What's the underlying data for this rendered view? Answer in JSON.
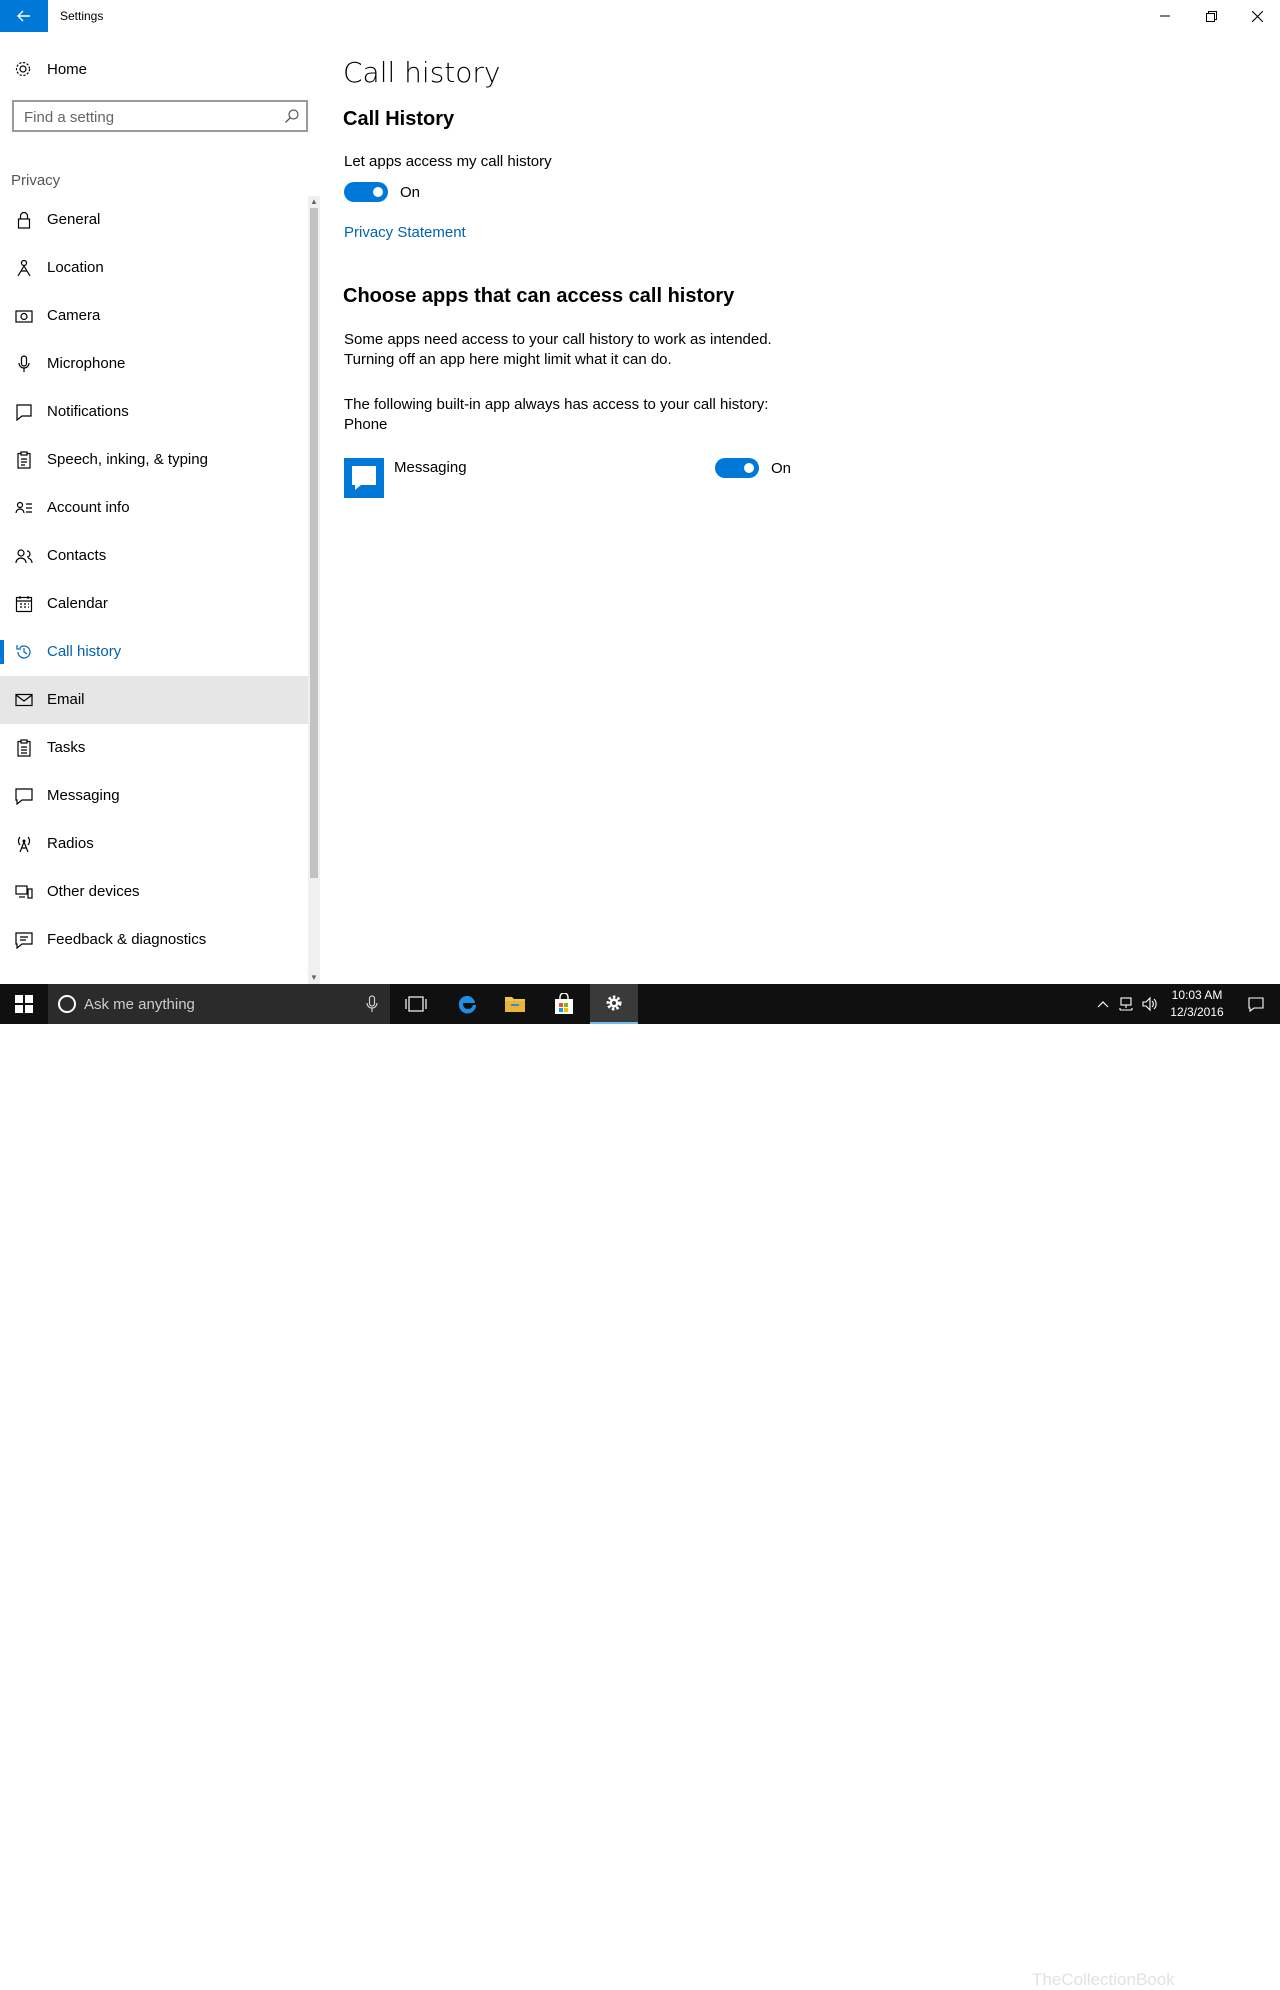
{
  "window": {
    "title": "Settings",
    "controls": [
      "minimize",
      "restore",
      "close"
    ]
  },
  "sidebar": {
    "home_label": "Home",
    "search_placeholder": "Find a setting",
    "section_label": "Privacy",
    "items": [
      {
        "label": "General",
        "icon": "lock-icon"
      },
      {
        "label": "Location",
        "icon": "location-person-icon"
      },
      {
        "label": "Camera",
        "icon": "camera-icon"
      },
      {
        "label": "Microphone",
        "icon": "microphone-icon"
      },
      {
        "label": "Notifications",
        "icon": "notification-icon"
      },
      {
        "label": "Speech, inking, & typing",
        "icon": "clipboard-icon"
      },
      {
        "label": "Account info",
        "icon": "account-info-icon"
      },
      {
        "label": "Contacts",
        "icon": "contacts-icon"
      },
      {
        "label": "Calendar",
        "icon": "calendar-icon"
      },
      {
        "label": "Call history",
        "icon": "history-icon",
        "active": true
      },
      {
        "label": "Email",
        "icon": "mail-icon",
        "hover": true
      },
      {
        "label": "Tasks",
        "icon": "tasks-icon"
      },
      {
        "label": "Messaging",
        "icon": "message-icon"
      },
      {
        "label": "Radios",
        "icon": "antenna-icon"
      },
      {
        "label": "Other devices",
        "icon": "devices-icon"
      },
      {
        "label": "Feedback & diagnostics",
        "icon": "feedback-icon"
      }
    ]
  },
  "main": {
    "page_title": "Call history",
    "section1_title": "Call History",
    "access_label": "Let apps access my call history",
    "access_toggle_state": "On",
    "privacy_link": "Privacy Statement",
    "section2_title": "Choose apps that can access call history",
    "description_line1": "Some apps need access to your call history to work as intended.",
    "description_line2": "Turning off an app here might limit what it can do.",
    "builtin_line1": "The following built-in app always has access to your call history:",
    "builtin_line2": "Phone",
    "apps": [
      {
        "name": "Messaging",
        "state": "On",
        "icon": "messaging-app-icon"
      }
    ]
  },
  "taskbar": {
    "search_placeholder": "Ask me anything",
    "time": "10:03 AM",
    "date": "12/3/2016",
    "watermark": "TheCollectionBook"
  },
  "colors": {
    "accent": "#0078d7",
    "link": "#0063b1",
    "taskbar": "#101010"
  }
}
